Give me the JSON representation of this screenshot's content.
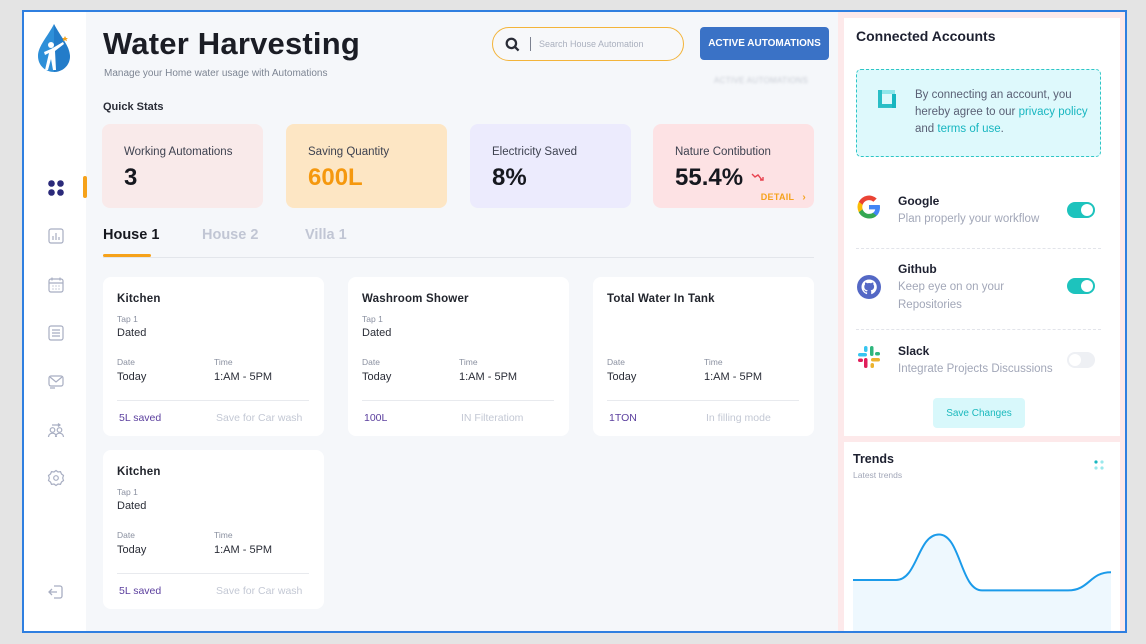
{
  "app": {
    "title": "Water Harvesting",
    "subtitle": "Manage your Home water usage with Automations"
  },
  "search": {
    "placeholder": "Search House Automation",
    "value": ""
  },
  "header": {
    "active_button": "ACTIVE AUTOMATIONS",
    "ghost_label": "ACTIVE AUTOMATIONS"
  },
  "sidebar": {
    "items": [
      {
        "name": "dashboard",
        "icon": "grid-icon",
        "active": true
      },
      {
        "name": "reports",
        "icon": "bar-chart-icon",
        "active": false
      },
      {
        "name": "calendar",
        "icon": "calendar-icon",
        "active": false
      },
      {
        "name": "list",
        "icon": "list-icon",
        "active": false
      },
      {
        "name": "messages",
        "icon": "message-icon",
        "active": false
      },
      {
        "name": "users",
        "icon": "users-icon",
        "active": false
      },
      {
        "name": "settings",
        "icon": "gear-icon",
        "active": false
      }
    ],
    "logout_icon": "logout-icon"
  },
  "quick_stats": {
    "label": "Quick Stats",
    "items": [
      {
        "label": "Working Automations",
        "value": "3"
      },
      {
        "label": "Saving Quantity",
        "value": "600L"
      },
      {
        "label": "Electricity Saved",
        "value": "8%"
      },
      {
        "label": "Nature Contibution",
        "value": "55.4%",
        "trend": "down",
        "link": "DETAIL",
        "link_icon": "›"
      }
    ],
    "colors": {
      "accent": "#f6a21a",
      "saving": "#f5980e"
    }
  },
  "tabs": [
    {
      "label": "House 1",
      "active": true
    },
    {
      "label": "House 2",
      "active": false
    },
    {
      "label": "Villa 1",
      "active": false
    }
  ],
  "cards": [
    {
      "title": "Kitchen",
      "tap": "Tap 1",
      "tap_value": "Dated",
      "date_label": "Date",
      "date": "Today",
      "time_label": "Time",
      "time": "1:AM - 5PM",
      "footer_left": "5L saved",
      "footer_right": "Save for Car wash"
    },
    {
      "title": "Washroom Shower",
      "tap": "Tap 1",
      "tap_value": "Dated",
      "date_label": "Date",
      "date": "Today",
      "time_label": "Time",
      "time": "1:AM - 5PM",
      "footer_left": "100L",
      "footer_right": "IN Filteratiom"
    },
    {
      "title": "Total Water In Tank",
      "tap": "",
      "tap_value": "",
      "date_label": "Date",
      "date": "Today",
      "time_label": "Time",
      "time": "1:AM - 5PM",
      "footer_left": "1TON",
      "footer_right": "In filling mode"
    },
    {
      "title": "Kitchen",
      "tap": "Tap 1",
      "tap_value": "Dated",
      "date_label": "Date",
      "date": "Today",
      "time_label": "Time",
      "time": "1:AM - 5PM",
      "footer_left": "5L saved",
      "footer_right": "Save for Car wash"
    }
  ],
  "connected_accounts": {
    "title": "Connected Accounts",
    "notice": {
      "text_before": "By connecting an account, you hereby agree to our ",
      "privacy_link": "privacy policy",
      "text_mid": " and ",
      "terms_link": "terms of use",
      "text_after": "."
    },
    "accounts": [
      {
        "name": "Google",
        "description": "Plan properly your workflow",
        "icon": "google-icon",
        "enabled": true
      },
      {
        "name": "Github",
        "description": "Keep eye on on your Repositories",
        "icon": "github-icon",
        "enabled": true
      },
      {
        "name": "Slack",
        "description": "Integrate Projects Discussions",
        "icon": "slack-icon",
        "enabled": false
      }
    ],
    "save_label": "Save Changes",
    "colors": {
      "teal": "#1dc3bd",
      "brand_blue": "#3a72c6"
    }
  },
  "trends": {
    "title": "Trends",
    "subtitle": "Latest trends"
  },
  "chart_data": {
    "type": "area",
    "title": "Trends",
    "subtitle": "Latest trends",
    "x": [
      0,
      1,
      2,
      3,
      4,
      5,
      6
    ],
    "values": [
      40,
      40,
      75,
      32,
      32,
      32,
      46
    ],
    "ylim": [
      0,
      100
    ],
    "grid": false,
    "legend": "none",
    "color": "#1b9bea",
    "fill": "#eef8fe"
  }
}
